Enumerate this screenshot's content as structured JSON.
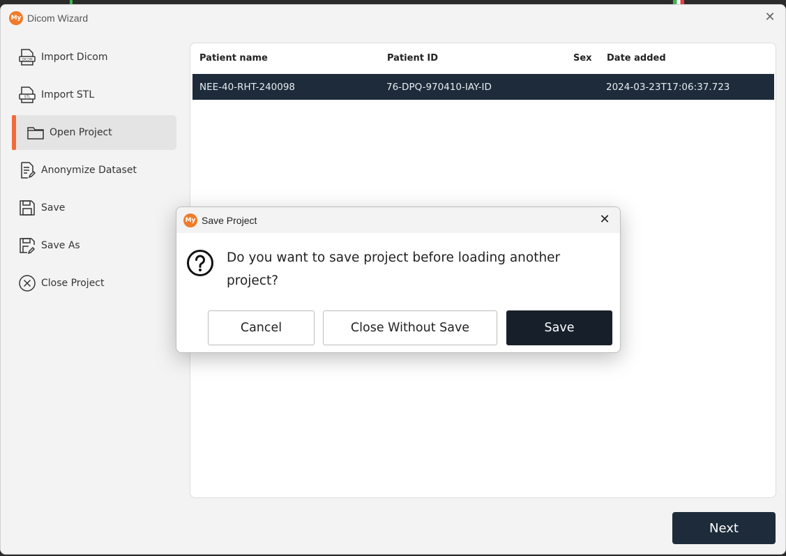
{
  "window": {
    "title": "Dicom Wizard",
    "logo_text": "My"
  },
  "sidebar": {
    "items": [
      {
        "label": "Import Dicom",
        "icon": "dicom-file-icon"
      },
      {
        "label": "Import STL",
        "icon": "stl-file-icon"
      },
      {
        "label": "Open Project",
        "icon": "folder-icon",
        "active": true
      },
      {
        "label": "Anonymize Dataset",
        "icon": "document-edit-icon"
      },
      {
        "label": "Save",
        "icon": "save-icon"
      },
      {
        "label": "Save As",
        "icon": "save-as-icon"
      },
      {
        "label": "Close Project",
        "icon": "close-circle-icon"
      }
    ]
  },
  "table": {
    "headers": [
      "Patient name",
      "Patient ID",
      "Sex",
      "Date added"
    ],
    "rows": [
      [
        "NEE-40-RHT-240098",
        "76-DPQ-970410-IAY-ID",
        "",
        "2024-03-23T17:06:37.723"
      ]
    ]
  },
  "next_label": "Next",
  "dialog": {
    "title": "Save Project",
    "logo_text": "My",
    "message": "Do you want to save project before loading another project?",
    "cancel_label": "Cancel",
    "close_without_save_label": "Close Without Save",
    "save_label": "Save"
  },
  "colors": {
    "accent": "#f26b3a",
    "dark": "#1d2b3a",
    "logo": "#f07b2a"
  }
}
